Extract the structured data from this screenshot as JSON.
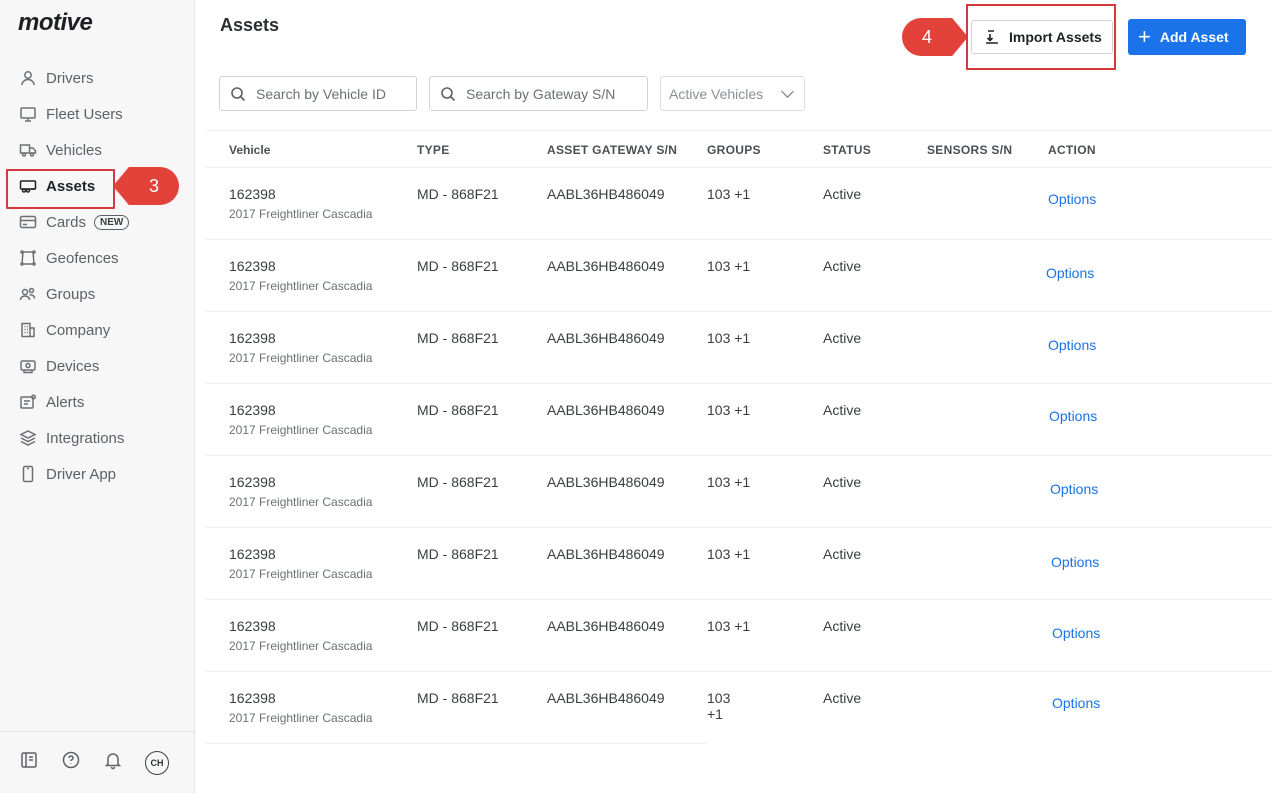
{
  "sidebar": {
    "logo": "motive",
    "items": [
      {
        "label": "Drivers",
        "icon": "person-icon"
      },
      {
        "label": "Fleet Users",
        "icon": "monitor-icon"
      },
      {
        "label": "Vehicles",
        "icon": "truck-icon"
      },
      {
        "label": "Assets",
        "icon": "trailer-icon",
        "active": true
      },
      {
        "label": "Cards",
        "icon": "card-icon",
        "badge": "NEW"
      },
      {
        "label": "Geofences",
        "icon": "geofence-icon"
      },
      {
        "label": "Groups",
        "icon": "group-icon"
      },
      {
        "label": "Company",
        "icon": "building-icon"
      },
      {
        "label": "Devices",
        "icon": "device-icon"
      },
      {
        "label": "Alerts",
        "icon": "alert-icon"
      },
      {
        "label": "Integrations",
        "icon": "layers-icon"
      },
      {
        "label": "Driver App",
        "icon": "phone-icon"
      }
    ],
    "footer": {
      "avatar": "CH"
    }
  },
  "callouts": {
    "step3": "3",
    "step4": "4"
  },
  "header": {
    "title": "Assets",
    "import_label": "Import Assets",
    "add_label": "Add Asset"
  },
  "filters": {
    "search_vehicle_placeholder": "Search by Vehicle ID",
    "search_gateway_placeholder": "Search by Gateway S/N",
    "status_select": "Active Vehicles"
  },
  "table": {
    "columns": [
      "Vehicle",
      "TYPE",
      "ASSET GATEWAY S/N",
      "GROUPS",
      "STATUS",
      "SENSORS S/N",
      "ACTION"
    ],
    "rows": [
      {
        "vehicle": "162398",
        "model": "2017 Freightliner Cascadia",
        "type": "MD - 868F21",
        "gateway": "AABL36HB486049",
        "groups": "103 +1",
        "status": "Active",
        "sensors": "",
        "action": "Options"
      },
      {
        "vehicle": "162398",
        "model": "2017 Freightliner Cascadia",
        "type": "MD - 868F21",
        "gateway": "AABL36HB486049",
        "groups": "103 +1",
        "status": "Active",
        "sensors": "",
        "action": "Options"
      },
      {
        "vehicle": "162398",
        "model": "2017 Freightliner Cascadia",
        "type": "MD - 868F21",
        "gateway": "AABL36HB486049",
        "groups": "103 +1",
        "status": "Active",
        "sensors": "",
        "action": "Options"
      },
      {
        "vehicle": "162398",
        "model": "2017 Freightliner Cascadia",
        "type": "MD - 868F21",
        "gateway": "AABL36HB486049",
        "groups": "103 +1",
        "status": "Active",
        "sensors": "",
        "action": "Options"
      },
      {
        "vehicle": "162398",
        "model": "2017 Freightliner Cascadia",
        "type": "MD - 868F21",
        "gateway": "AABL36HB486049",
        "groups": "103 +1",
        "status": "Active",
        "sensors": "",
        "action": "Options"
      },
      {
        "vehicle": "162398",
        "model": "2017 Freightliner Cascadia",
        "type": "MD - 868F21",
        "gateway": "AABL36HB486049",
        "groups": "103 +1",
        "status": "Active",
        "sensors": "",
        "action": "Options"
      },
      {
        "vehicle": "162398",
        "model": "2017 Freightliner Cascadia",
        "type": "MD - 868F21",
        "gateway": "AABL36HB486049",
        "groups": "103 +1",
        "status": "Active",
        "sensors": "",
        "action": "Options"
      },
      {
        "vehicle": "162398",
        "model": "2017 Freightliner Cascadia",
        "type": "MD - 868F21",
        "gateway": "AABL36HB486049",
        "groups": "103 +1",
        "status": "Active",
        "sensors": "",
        "action": "Options"
      }
    ]
  },
  "colors": {
    "accent": "#1a73e8",
    "callout": "#e3423b",
    "highlight_border": "#d43a3a"
  }
}
